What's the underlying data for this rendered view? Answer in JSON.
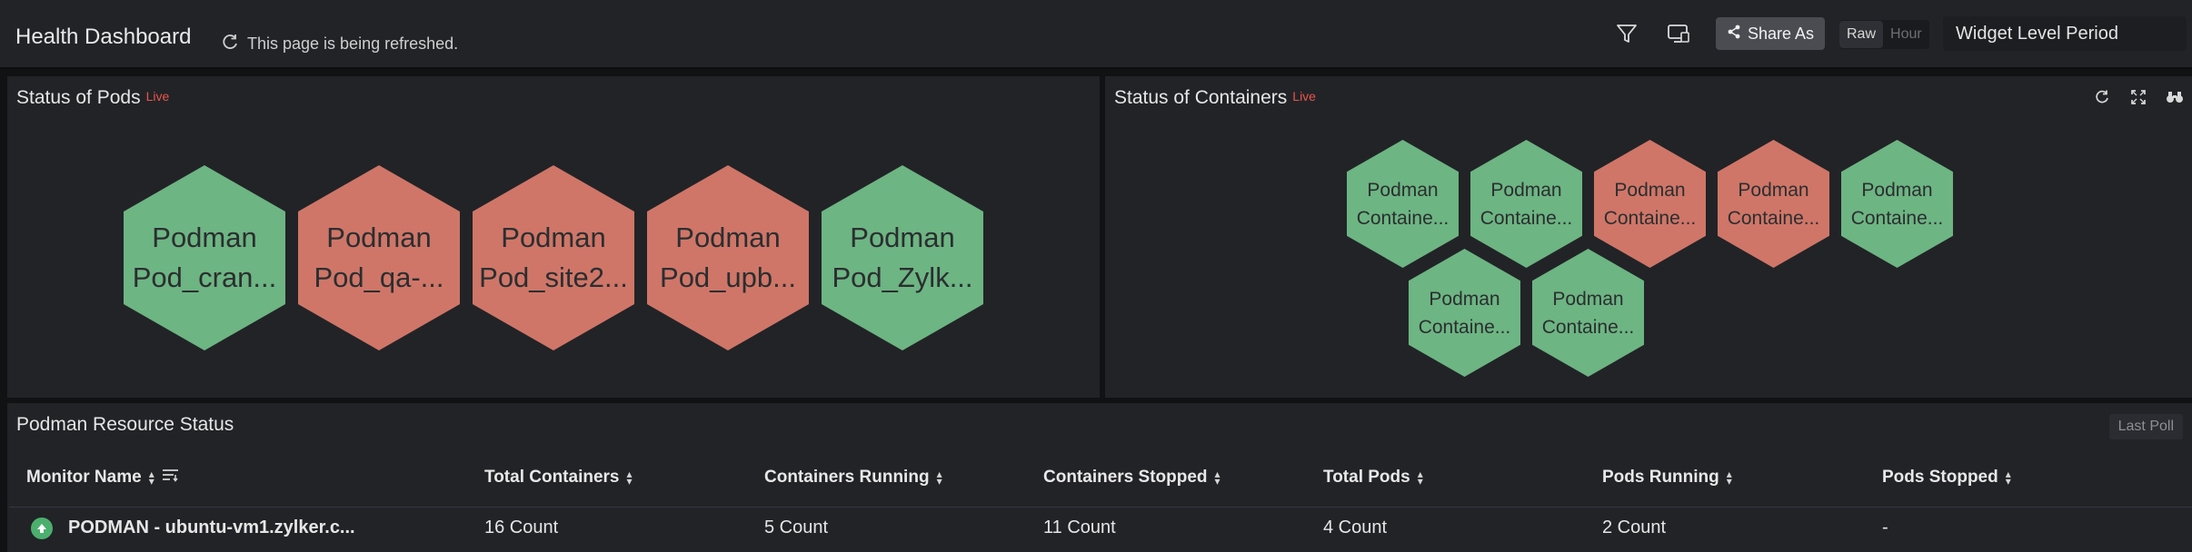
{
  "header": {
    "title": "Health Dashboard",
    "refresh_text": "This page is being refreshed.",
    "share_label": "Share As",
    "toggle": {
      "active": "Raw",
      "inactive": "Hour"
    },
    "period": "Widget Level Period"
  },
  "pods_panel": {
    "title": "Status of Pods",
    "live": "Live",
    "items": [
      {
        "line1": "Podman",
        "line2": "Pod_cran...",
        "status": "up",
        "color": "#6db583"
      },
      {
        "line1": "Podman",
        "line2": "Pod_qa-...",
        "status": "down",
        "color": "#cf7668"
      },
      {
        "line1": "Podman",
        "line2": "Pod_site2...",
        "status": "down",
        "color": "#cf7668"
      },
      {
        "line1": "Podman",
        "line2": "Pod_upb...",
        "status": "down",
        "color": "#cf7668"
      },
      {
        "line1": "Podman",
        "line2": "Pod_Zylk...",
        "status": "up",
        "color": "#6db583"
      }
    ]
  },
  "containers_panel": {
    "title": "Status of Containers",
    "live": "Live",
    "items": [
      {
        "line1": "Podman",
        "line2": "Containe...",
        "status": "up"
      },
      {
        "line1": "Podman",
        "line2": "Containe...",
        "status": "up"
      },
      {
        "line1": "Podman",
        "line2": "Containe...",
        "status": "down"
      },
      {
        "line1": "Podman",
        "line2": "Containe...",
        "status": "down"
      },
      {
        "line1": "Podman",
        "line2": "Containe...",
        "status": "up"
      },
      {
        "line1": "Podman",
        "line2": "Containe...",
        "status": "up"
      },
      {
        "line1": "Podman",
        "line2": "Containe...",
        "status": "up"
      }
    ]
  },
  "resource_panel": {
    "title": "Podman Resource Status",
    "last_poll": "Last Poll",
    "columns": [
      "Monitor Name",
      "Total Containers",
      "Containers Running",
      "Containers Stopped",
      "Total Pods",
      "Pods Running",
      "Pods Stopped"
    ],
    "rows": [
      [
        "PODMAN - ubuntu-vm1.zylker.c...",
        "16 Count",
        "5 Count",
        "11 Count",
        "4 Count",
        "2 Count",
        "-"
      ]
    ]
  },
  "colors": {
    "up": "#6db583",
    "down": "#cf7668",
    "live": "#e8554a",
    "status_up": "#4caf6e"
  }
}
